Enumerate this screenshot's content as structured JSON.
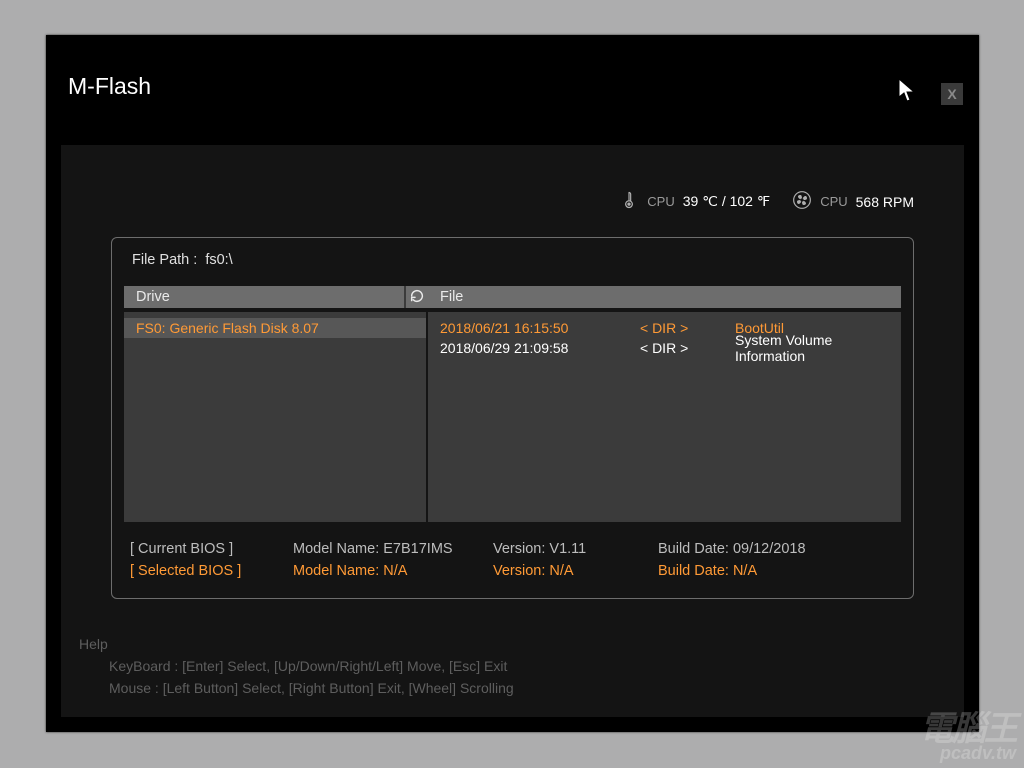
{
  "window": {
    "title": "M-Flash",
    "close_label": "X"
  },
  "cpu": {
    "temp_label": "CPU",
    "temp_value": "39 ℃ / 102 ℉",
    "fan_label": "CPU",
    "fan_value": "568 RPM"
  },
  "file_path": {
    "label": "File Path :",
    "value": "fs0:\\"
  },
  "columns": {
    "drive": "Drive",
    "file": "File"
  },
  "drives": [
    {
      "label": "FS0: Generic Flash Disk 8.07",
      "selected": true
    }
  ],
  "files": [
    {
      "date": "2018/06/21 16:15:50",
      "type": "< DIR >",
      "name": "BootUtil",
      "highlighted": true
    },
    {
      "date": "2018/06/29 21:09:58",
      "type": "< DIR >",
      "name": "System Volume Information",
      "highlighted": false
    }
  ],
  "bios": {
    "current": {
      "tag": "[ Current BIOS   ]",
      "model": "Model Name: E7B17IMS",
      "version": "Version: V1.11",
      "build": "Build Date: 09/12/2018"
    },
    "selected": {
      "tag": "[ Selected BIOS ]",
      "model": "Model Name: N/A",
      "version": "Version: N/A",
      "build": "Build Date: N/A"
    }
  },
  "help": {
    "title": "Help",
    "keyboard": "KeyBoard :   [Enter]  Select,    [Up/Down/Right/Left]  Move,    [Esc]  Exit",
    "mouse": "Mouse     :   [Left Button]  Select,    [Right Button]  Exit,    [Wheel]  Scrolling"
  },
  "watermark": {
    "line1": "電腦王",
    "line2": "pcadv.tw"
  }
}
